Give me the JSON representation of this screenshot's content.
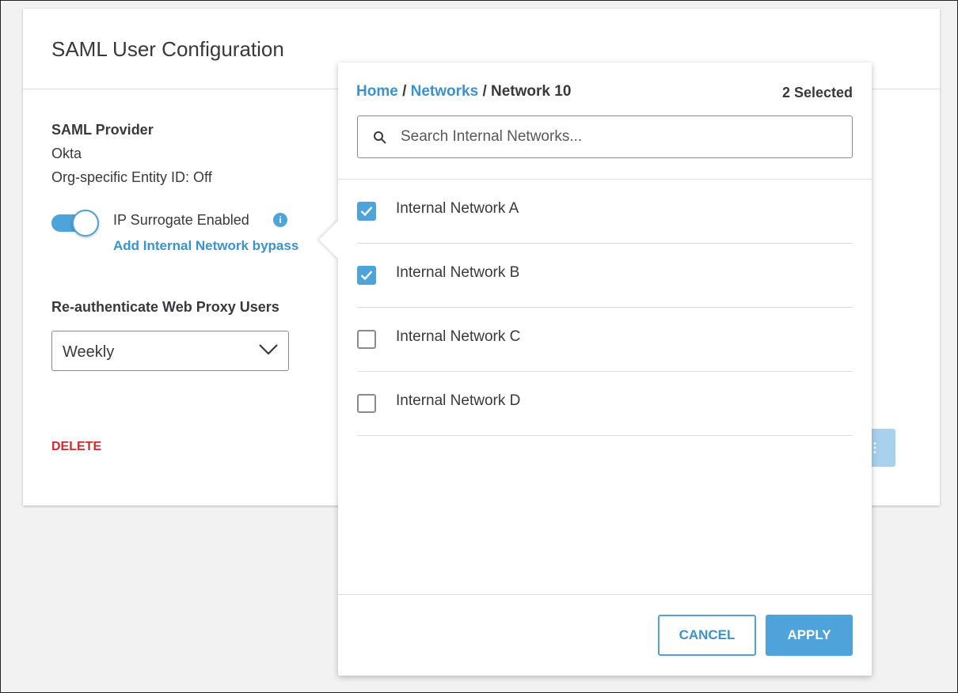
{
  "card": {
    "title": "SAML User Configuration",
    "provider_label": "SAML Provider",
    "provider_value": "Okta",
    "entity_id": "Org-specific Entity ID: Off",
    "surrogate_label": "IP Surrogate Enabled",
    "surrogate_enabled": true,
    "info_icon": "i",
    "bypass_link": "Add Internal Network bypass",
    "reauth_label": "Re-authenticate Web Proxy Users",
    "reauth_value": "Weekly",
    "delete_label": "DELETE"
  },
  "popover": {
    "breadcrumb": {
      "home": "Home",
      "networks": "Networks",
      "current": "Network 10",
      "separator": "/"
    },
    "selected_count": "2 Selected",
    "search_placeholder": "Search Internal Networks...",
    "items": [
      {
        "label": "Internal Network A",
        "checked": true
      },
      {
        "label": "Internal Network B",
        "checked": true
      },
      {
        "label": "Internal Network C",
        "checked": false
      },
      {
        "label": "Internal Network D",
        "checked": false
      }
    ],
    "cancel_label": "CANCEL",
    "apply_label": "APPLY"
  },
  "colors": {
    "accent": "#4fa3db",
    "link": "#3a92cf",
    "danger": "#cf2b2b"
  }
}
